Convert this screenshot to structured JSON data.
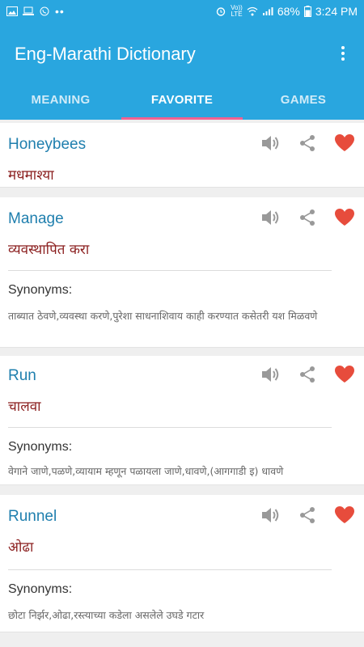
{
  "status_bar": {
    "battery": "68%",
    "time": "3:24 PM",
    "volte_top": "Vo))",
    "volte_bottom": "LTE",
    "dots": "••"
  },
  "app": {
    "title": "Eng-Marathi Dictionary"
  },
  "tabs": [
    {
      "label": "MEANING",
      "active": false
    },
    {
      "label": "FAVORITE",
      "active": true
    },
    {
      "label": "GAMES",
      "active": false
    }
  ],
  "colors": {
    "primary": "#29a6df",
    "accent": "#f06292",
    "word": "#1f7fae",
    "meaning": "#8b1f1f",
    "heart": "#e74c3c"
  },
  "icons": [
    "speaker-icon",
    "share-icon",
    "heart-icon"
  ],
  "favorites": [
    {
      "word": "Honeybees",
      "meaning": "मधमाश्या"
    },
    {
      "word": "Manage",
      "meaning": "व्यवस्थापित करा",
      "synonyms_label": "Synonyms:",
      "synonyms": "ताब्यात ठेवणे,व्यवस्था करणे,पुरेशा साधनाशिवाय काही करण्यात कसेतरी यश मिळवणे"
    },
    {
      "word": "Run",
      "meaning": "चालवा",
      "synonyms_label": "Synonyms:",
      "synonyms": "वेगाने जाणे,पळणे,व्यायाम म्हणून पळायला जाणे,धावणे,(आगगाडी इ) धावणे"
    },
    {
      "word": "Runnel",
      "meaning": "ओढा",
      "synonyms_label": "Synonyms:",
      "synonyms": "छोटा निर्झर,ओढा,रस्त्याच्या कडेला असलेले उघडे गटार"
    }
  ]
}
